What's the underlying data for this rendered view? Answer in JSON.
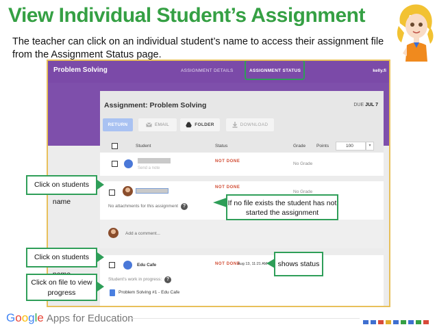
{
  "slide": {
    "title": "View Individual Student’s Assignment",
    "subtitle": "The teacher can click on an individual student’s name to access their assignment file from the Assignment Status page."
  },
  "topbar": {
    "app_name": "Problem Solving",
    "tabs": [
      "ASSIGNMENT DETAILS",
      "ASSIGNMENT STATUS"
    ],
    "user": "kelly.fi"
  },
  "assignment": {
    "title": "Assignment: Problem Solving",
    "due_label": "DUE",
    "due_date": "JUL 7",
    "buttons": {
      "return": "RETURN",
      "email": "EMAIL",
      "folder": "FOLDER",
      "download": "DOWNLOAD"
    }
  },
  "table": {
    "headers": {
      "student": "Student",
      "status": "Status",
      "grade": "Grade",
      "points": "Points"
    },
    "points_value": "100",
    "rows": [
      {
        "sub": "Send a note",
        "status": "NOT DONE",
        "grade": "No Grade"
      },
      {
        "status": "NOT DONE",
        "grade": "No Grade",
        "attachments": "No attachments for this assignment",
        "comment_placeholder": "Add a comment..."
      },
      {
        "name": "Edu Cafe",
        "status": "NOT DONE",
        "date": "Aug 13, 11:21 AM",
        "work_label": "Student's work in progress:",
        "file": "Problem Solving #1 - Edu Cafe"
      }
    ]
  },
  "callouts": {
    "click_students_1": "Click on students name",
    "no_file": "If no file exists the student has not started the assignment",
    "click_students_2": "Click on students name",
    "shows_status": "shows status",
    "click_file": "Click on file to view progress"
  },
  "footer": {
    "google": "Google",
    "apps": "Apps for Education"
  },
  "colors": {
    "title_green": "#35a044",
    "classroom_purple": "#7b4aa8",
    "callout_border": "#2e9e58",
    "not_done": "#d0462d"
  },
  "footer_dots_colors": [
    "#3f6fd0",
    "#3f6fd0",
    "#d84a3a",
    "#e0ad2c",
    "#3f6fd0",
    "#35a044",
    "#3f6fd0",
    "#35a044",
    "#d84a3a"
  ]
}
